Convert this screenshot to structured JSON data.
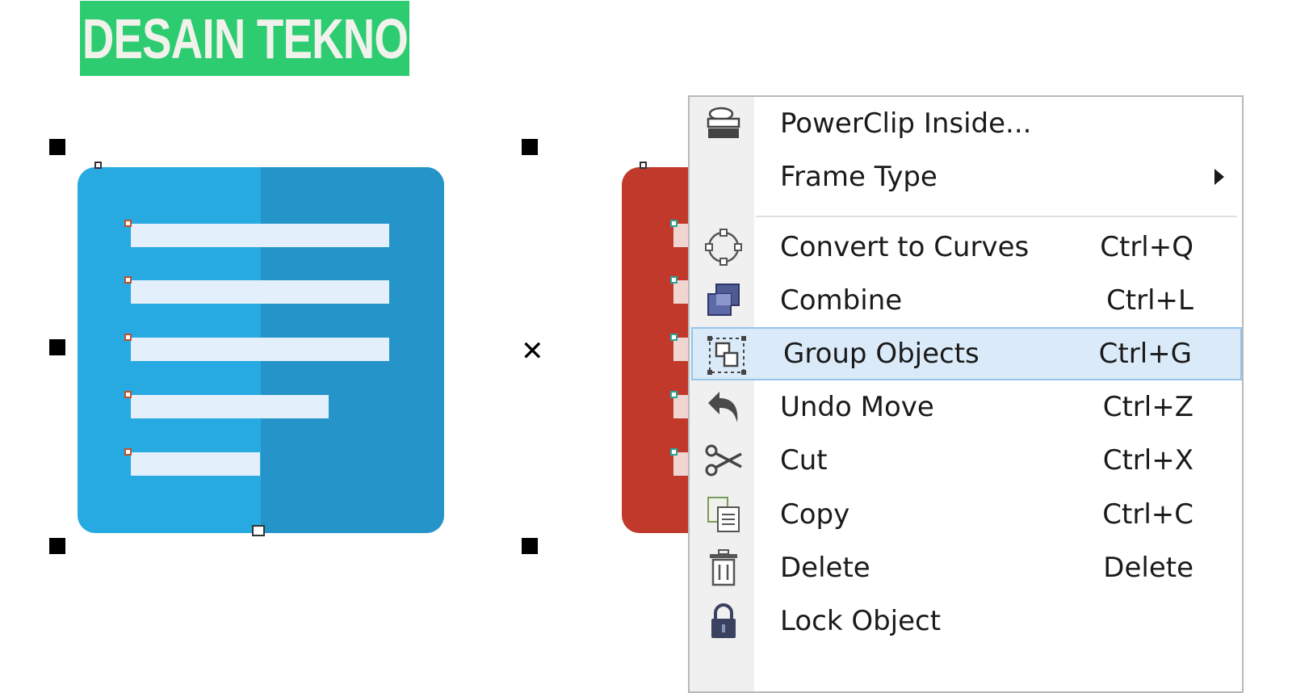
{
  "logo": {
    "text": "DESAIN TEKNO",
    "color": "#2ecc71"
  },
  "canvas": {
    "blue_icon_color": "#27a9e1",
    "red_icon_color": "#c0392b"
  },
  "context_menu": {
    "items": [
      {
        "label": "PowerClip Inside...",
        "shortcut": "",
        "icon": "powerclip-icon"
      },
      {
        "label": "Frame Type",
        "shortcut": "",
        "icon": "",
        "has_submenu": true
      },
      {
        "label": "Convert to Curves",
        "shortcut": "Ctrl+Q",
        "icon": "convert-curves-icon"
      },
      {
        "label": "Combine",
        "shortcut": "Ctrl+L",
        "icon": "combine-icon"
      },
      {
        "label": "Group Objects",
        "shortcut": "Ctrl+G",
        "icon": "group-icon",
        "highlighted": true
      },
      {
        "label": "Undo Move",
        "shortcut": "Ctrl+Z",
        "icon": "undo-icon"
      },
      {
        "label": "Cut",
        "shortcut": "Ctrl+X",
        "icon": "scissors-icon"
      },
      {
        "label": "Copy",
        "shortcut": "Ctrl+C",
        "icon": "copy-icon"
      },
      {
        "label": "Delete",
        "shortcut": "Delete",
        "icon": "trash-icon"
      },
      {
        "label": "Lock Object",
        "shortcut": "",
        "icon": "lock-icon"
      }
    ]
  }
}
